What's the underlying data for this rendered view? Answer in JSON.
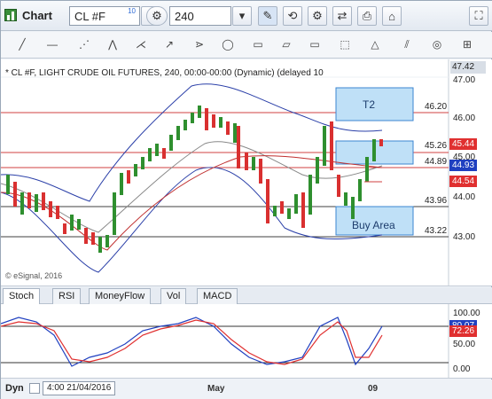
{
  "window": {
    "title": "Chart",
    "symbol_value": "CL #F",
    "symbol_superscript": "10",
    "interval_value": "240"
  },
  "toolbar": {
    "icons": [
      "symbol-dropdown-icon",
      "refresh-icon",
      "interval-dropdown-icon",
      "pencil-icon",
      "cursor-icon",
      "properties-icon",
      "link-icon",
      "print-icon",
      "tag-icon",
      "expand-icon"
    ]
  },
  "drawing_tools": [
    "line-tool-icon",
    "horizontal-line-icon",
    "gann-fan-icon",
    "pitchfork-icon",
    "fibonacci-icon",
    "arrow-icon",
    "ellipse-icon",
    "rectangle-icon",
    "parallelogram-icon",
    "text-box-icon",
    "label-icon",
    "channel-icon",
    "circle-target-icon",
    "more-tools-icon"
  ],
  "chart": {
    "header": "* CL #F, LIGHT CRUDE OIL FUTURES, 240, 00:00-00:00 (Dynamic) (delayed 10",
    "copyright": "© eSignal, 2016",
    "price_axis": [
      "47.42",
      "47.00",
      "46.00",
      "45.00",
      "44.00",
      "43.00"
    ],
    "horizontal_levels": [
      "46.20",
      "45.26",
      "44.89",
      "43.96",
      "43.22"
    ],
    "price_tags": [
      {
        "value": "45.44",
        "color": "#e03030"
      },
      {
        "value": "44.93",
        "color": "#2040c0"
      },
      {
        "value": "44.54",
        "color": "#e03030"
      }
    ],
    "zone_labels": {
      "target": "T2",
      "buy": "Buy Area"
    }
  },
  "indicator_tabs": [
    "Stoch",
    "RSI",
    "MoneyFlow",
    "Vol",
    "MACD"
  ],
  "oscillator": {
    "axis": [
      "100.00",
      "50.00",
      "0.00"
    ],
    "tags": [
      {
        "value": "80.07",
        "color": "#2040c0"
      },
      {
        "value": "72.26",
        "color": "#e03030"
      }
    ]
  },
  "timebar": {
    "mode": "Dyn",
    "cursor_date": "4:00 21/04/2016",
    "labels": [
      "May",
      "09"
    ]
  }
}
